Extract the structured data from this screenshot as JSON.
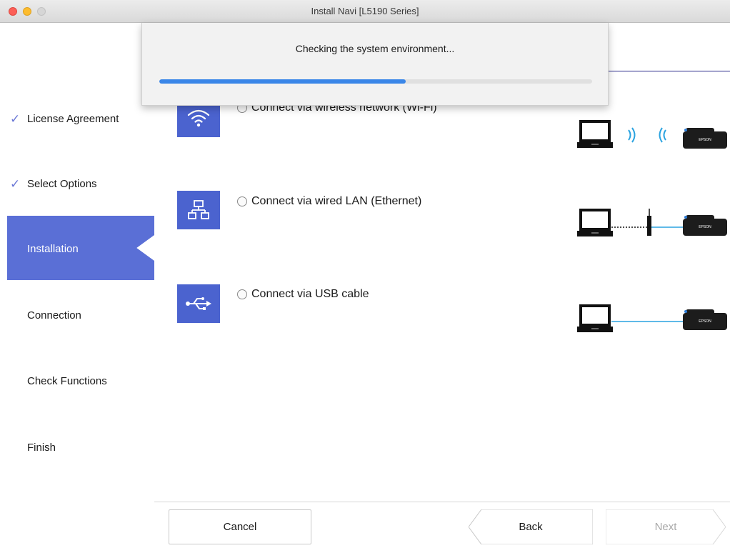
{
  "window": {
    "title": "Install Navi [L5190 Series]"
  },
  "sidebar": {
    "items": [
      {
        "label": "License Agreement",
        "done": true
      },
      {
        "label": "Select Options",
        "done": true
      },
      {
        "label": "Installation",
        "active": true
      },
      {
        "label": "Connection"
      },
      {
        "label": "Check Functions"
      },
      {
        "label": "Finish"
      }
    ],
    "check_glyph": "✓"
  },
  "connection_options": [
    {
      "label": "Connect via wireless network (Wi-Fi)",
      "icon": "wifi-icon"
    },
    {
      "label": "Connect via wired LAN (Ethernet)",
      "icon": "ethernet-network-icon"
    },
    {
      "label": "Connect via USB cable",
      "icon": "usb-icon"
    }
  ],
  "diagram": {
    "printer_brand": "EPSON"
  },
  "progress_dialog": {
    "message": "Checking the system environment...",
    "progress": 0.57
  },
  "footer": {
    "cancel_label": "Cancel",
    "back_label": "Back",
    "next_label": "Next"
  },
  "colors": {
    "accent": "#4b63cf",
    "sidebar_active": "#5a6fd6",
    "progress": "#3a86e8",
    "diagram_line": "#2aa3e0"
  }
}
